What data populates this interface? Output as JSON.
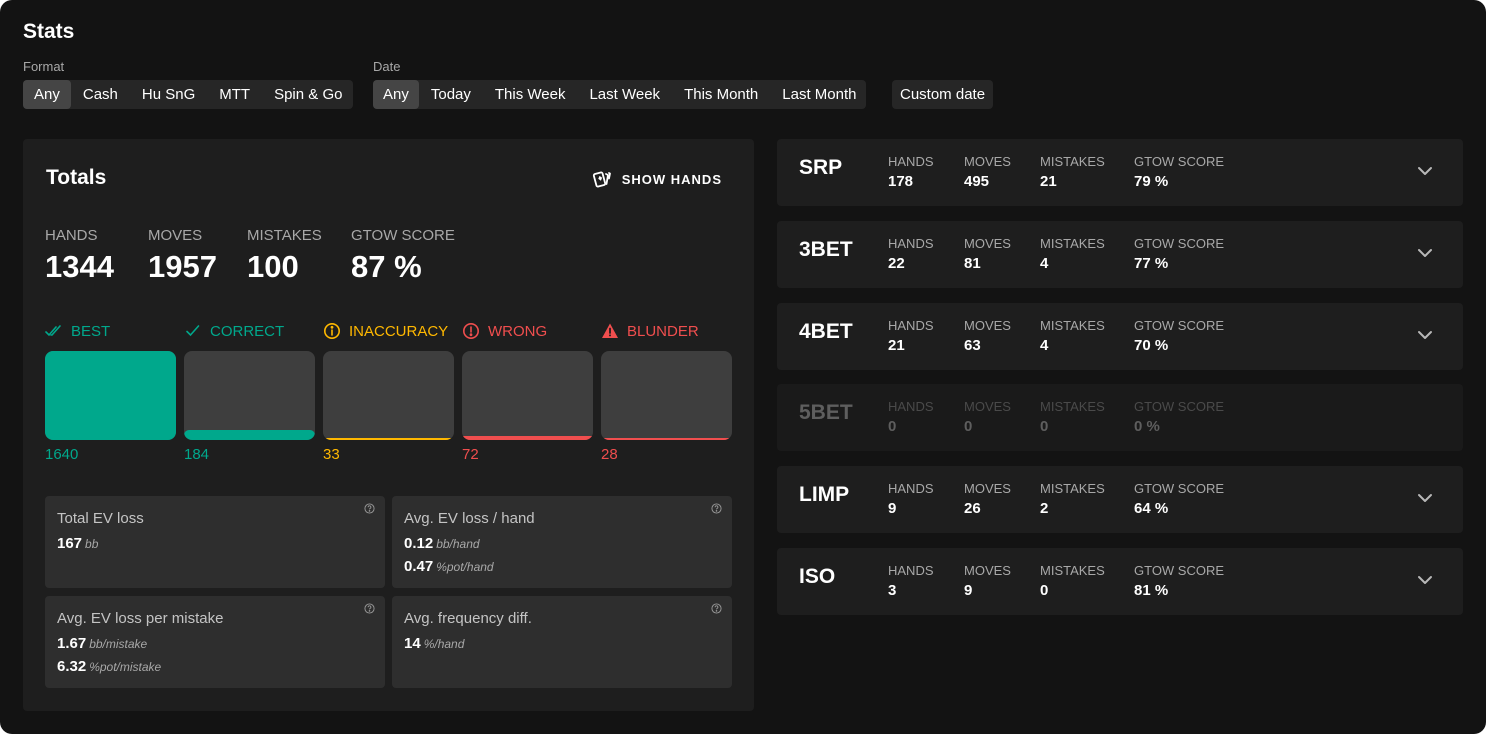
{
  "page": {
    "title": "Stats"
  },
  "filters": {
    "format": {
      "label": "Format",
      "options": [
        "Any",
        "Cash",
        "Hu SnG",
        "MTT",
        "Spin & Go"
      ],
      "selected": "Any"
    },
    "date": {
      "label": "Date",
      "options": [
        "Any",
        "Today",
        "This Week",
        "Last Week",
        "This Month",
        "Last Month"
      ],
      "selected": "Any",
      "custom_label": "Custom date"
    }
  },
  "totals": {
    "title": "Totals",
    "show_hands_label": "SHOW HANDS",
    "stats": [
      {
        "label": "HANDS",
        "value": "1344"
      },
      {
        "label": "MOVES",
        "value": "1957"
      },
      {
        "label": "MISTAKES",
        "value": "100"
      },
      {
        "label": "GTOW SCORE",
        "value": "87 %"
      }
    ],
    "categories": [
      {
        "label": "BEST",
        "icon": "double-check-icon",
        "count": "1640",
        "fill_fraction": 1.0,
        "color": "#00a88c"
      },
      {
        "label": "CORRECT",
        "icon": "check-icon",
        "count": "184",
        "fill_fraction": 0.112,
        "color": "#00a88c"
      },
      {
        "label": "INACCURACY",
        "icon": "info-circle-icon",
        "count": "33",
        "fill_fraction": 0.02,
        "color": "#ffb800"
      },
      {
        "label": "WRONG",
        "icon": "exclamation-circle-icon",
        "count": "72",
        "fill_fraction": 0.044,
        "color": "#f04e4e"
      },
      {
        "label": "BLUNDER",
        "icon": "warning-triangle-icon",
        "count": "28",
        "fill_fraction": 0.017,
        "color": "#f04e4e"
      }
    ],
    "ev_cards": [
      {
        "title": "Total EV loss",
        "lines": [
          {
            "value": "167",
            "unit": "bb"
          }
        ]
      },
      {
        "title": "Avg. EV loss / hand",
        "lines": [
          {
            "value": "0.12",
            "unit": "bb/hand"
          },
          {
            "value": "0.47",
            "unit": "%pot/hand"
          }
        ]
      },
      {
        "title": "Avg. EV loss per mistake",
        "lines": [
          {
            "value": "1.67",
            "unit": "bb/mistake"
          },
          {
            "value": "6.32",
            "unit": "%pot/mistake"
          }
        ]
      },
      {
        "title": "Avg. frequency diff.",
        "lines": [
          {
            "value": "14",
            "unit": "%/hand"
          }
        ]
      }
    ]
  },
  "spots": [
    {
      "name": "SRP",
      "hands": "178",
      "moves": "495",
      "mistakes": "21",
      "score": "79 %",
      "enabled": true
    },
    {
      "name": "3BET",
      "hands": "22",
      "moves": "81",
      "mistakes": "4",
      "score": "77 %",
      "enabled": true
    },
    {
      "name": "4BET",
      "hands": "21",
      "moves": "63",
      "mistakes": "4",
      "score": "70 %",
      "enabled": true
    },
    {
      "name": "5BET",
      "hands": "0",
      "moves": "0",
      "mistakes": "0",
      "score": "0 %",
      "enabled": false
    },
    {
      "name": "LIMP",
      "hands": "9",
      "moves": "26",
      "mistakes": "2",
      "score": "64 %",
      "enabled": true
    },
    {
      "name": "ISO",
      "hands": "3",
      "moves": "9",
      "mistakes": "0",
      "score": "81 %",
      "enabled": true
    }
  ],
  "spot_labels": {
    "hands": "HANDS",
    "moves": "MOVES",
    "mistakes": "MISTAKES",
    "score": "GTOW SCORE"
  }
}
